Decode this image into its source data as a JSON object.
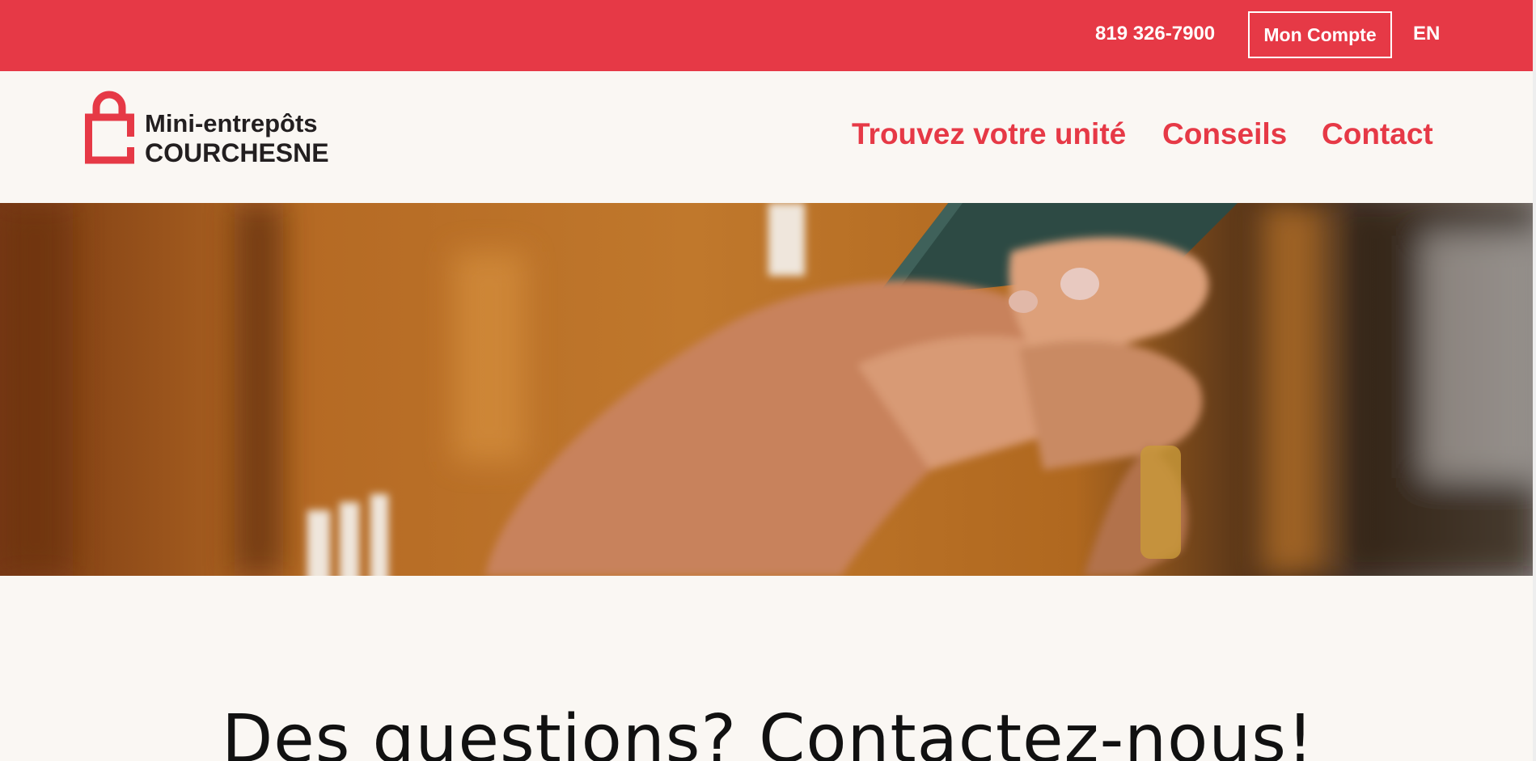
{
  "topbar": {
    "phone": "819 326-7900",
    "account_label": "Mon Compte",
    "language_label": "EN"
  },
  "logo": {
    "line1": "Mini-entrepôts",
    "line2": "COURCHESNE"
  },
  "nav": {
    "items": [
      {
        "label": "Trouvez votre unité"
      },
      {
        "label": "Conseils"
      },
      {
        "label": "Contact"
      }
    ]
  },
  "hero": {
    "icon": "hands-holding-phone-photo"
  },
  "main": {
    "title": "Des questions? Contactez-nous!"
  },
  "colors": {
    "brand_red": "#e63946",
    "background": "#faf7f3",
    "text_dark": "#231f20"
  }
}
